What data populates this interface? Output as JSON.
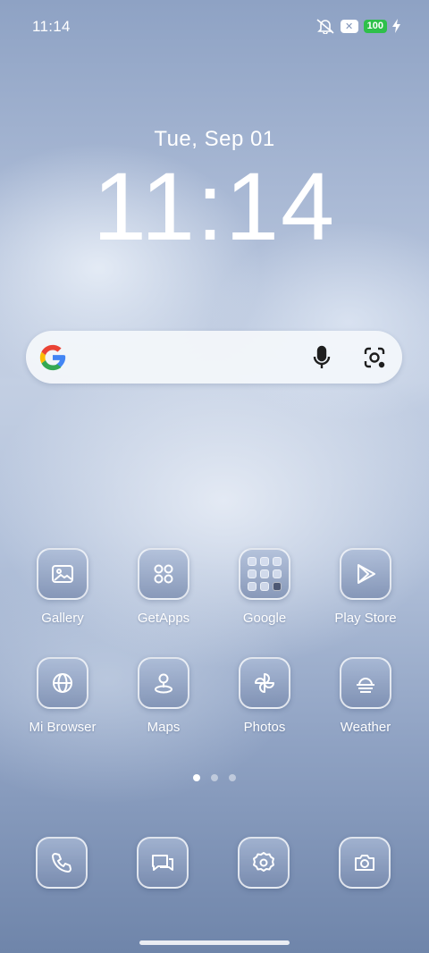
{
  "status_bar": {
    "time": "11:14",
    "notification_badge": "✕",
    "battery_level": "100",
    "icons": [
      "mute-icon",
      "notification-badge",
      "battery-icon",
      "charging-icon"
    ]
  },
  "clock": {
    "date": "Tue, Sep 01",
    "time": "11:14"
  },
  "search_bar": {
    "icons": [
      "google-logo-icon",
      "microphone-icon",
      "google-lens-icon"
    ],
    "colors": {
      "background": "#f3f6fa",
      "mic": "#1f1f1f"
    }
  },
  "apps": [
    {
      "label": "Gallery",
      "icon": "gallery-icon"
    },
    {
      "label": "GetApps",
      "icon": "getapps-icon"
    },
    {
      "label": "Google",
      "icon": "google-folder-icon"
    },
    {
      "label": "Play Store",
      "icon": "play-store-icon"
    },
    {
      "label": "Mi Browser",
      "icon": "globe-icon"
    },
    {
      "label": "Maps",
      "icon": "map-pin-icon"
    },
    {
      "label": "Photos",
      "icon": "pinwheel-icon"
    },
    {
      "label": "Weather",
      "icon": "weather-icon"
    }
  ],
  "page_indicator": {
    "total": 3,
    "current": 1
  },
  "dock": [
    {
      "icon": "phone-icon"
    },
    {
      "icon": "messages-icon"
    },
    {
      "icon": "settings-gear-icon"
    },
    {
      "icon": "camera-icon"
    }
  ],
  "colors": {
    "battery": "#2ec04a",
    "icon_tile": "#8c9dc0",
    "wallpaper": "#a8b8d4"
  }
}
